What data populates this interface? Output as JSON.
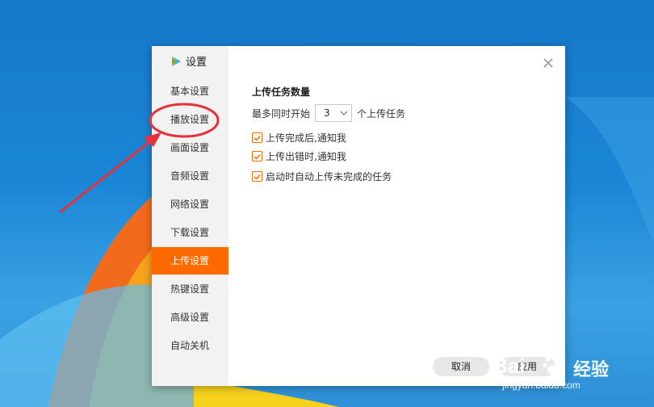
{
  "dialog": {
    "title": "设置",
    "close_icon": "close-icon",
    "nav": [
      {
        "label": "基本设置",
        "active": false
      },
      {
        "label": "播放设置",
        "active": false
      },
      {
        "label": "画面设置",
        "active": false
      },
      {
        "label": "音频设置",
        "active": false
      },
      {
        "label": "网络设置",
        "active": false
      },
      {
        "label": "下载设置",
        "active": false
      },
      {
        "label": "上传设置",
        "active": true
      },
      {
        "label": "热键设置",
        "active": false
      },
      {
        "label": "高级设置",
        "active": false
      },
      {
        "label": "自动关机",
        "active": false
      }
    ],
    "section_title": "上传任务数量",
    "concurrent_prefix": "最多同时开始",
    "concurrent_value": "3",
    "concurrent_suffix": "个上传任务",
    "options": [
      {
        "label": "上传完成后,通知我",
        "checked": true
      },
      {
        "label": "上传出错时,通知我",
        "checked": true
      },
      {
        "label": "启动时自动上传未完成的任务",
        "checked": true
      }
    ],
    "cancel_label": "取消",
    "apply_label": "应用"
  },
  "watermark": {
    "brand": "Bai",
    "text": "经验",
    "url": "jingyan.baidu.com"
  },
  "colors": {
    "accent": "#ff6a00",
    "annotation": "#e8303a",
    "desktop": "#1b86d6"
  }
}
